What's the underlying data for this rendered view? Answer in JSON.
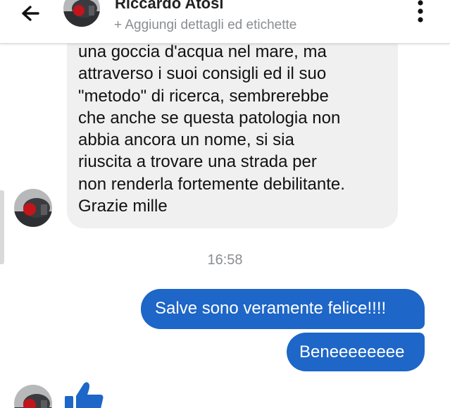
{
  "header": {
    "contact_name": "Riccardo Atosi",
    "add_details": "+ Aggiungi dettagli ed etichette",
    "back_icon": "arrow-left-icon",
    "menu_icon": "vertical-dots-icon"
  },
  "messages": {
    "incoming_lines": [
      "una goccia d'acqua nel mare, ma",
      "attraverso i suoi consigli ed il suo",
      "\"metodo\" di ricerca, sembrerebbe",
      "che anche se questa patologia non",
      "abbia ancora un nome, si sia",
      "riuscita a trovare una strada per",
      "non renderla fortemente debilitante.",
      "Grazie mille"
    ],
    "timestamp": "16:58",
    "outgoing": [
      "Salve sono veramente felice!!!!",
      "Beneeeeeeee"
    ],
    "reaction_icon": "thumbs-up-icon"
  },
  "colors": {
    "outgoing_bubble": "#1e66c7",
    "incoming_bubble": "#f0f0f0",
    "like_icon": "#1e66c7",
    "secondary_text": "#8a8d91"
  }
}
